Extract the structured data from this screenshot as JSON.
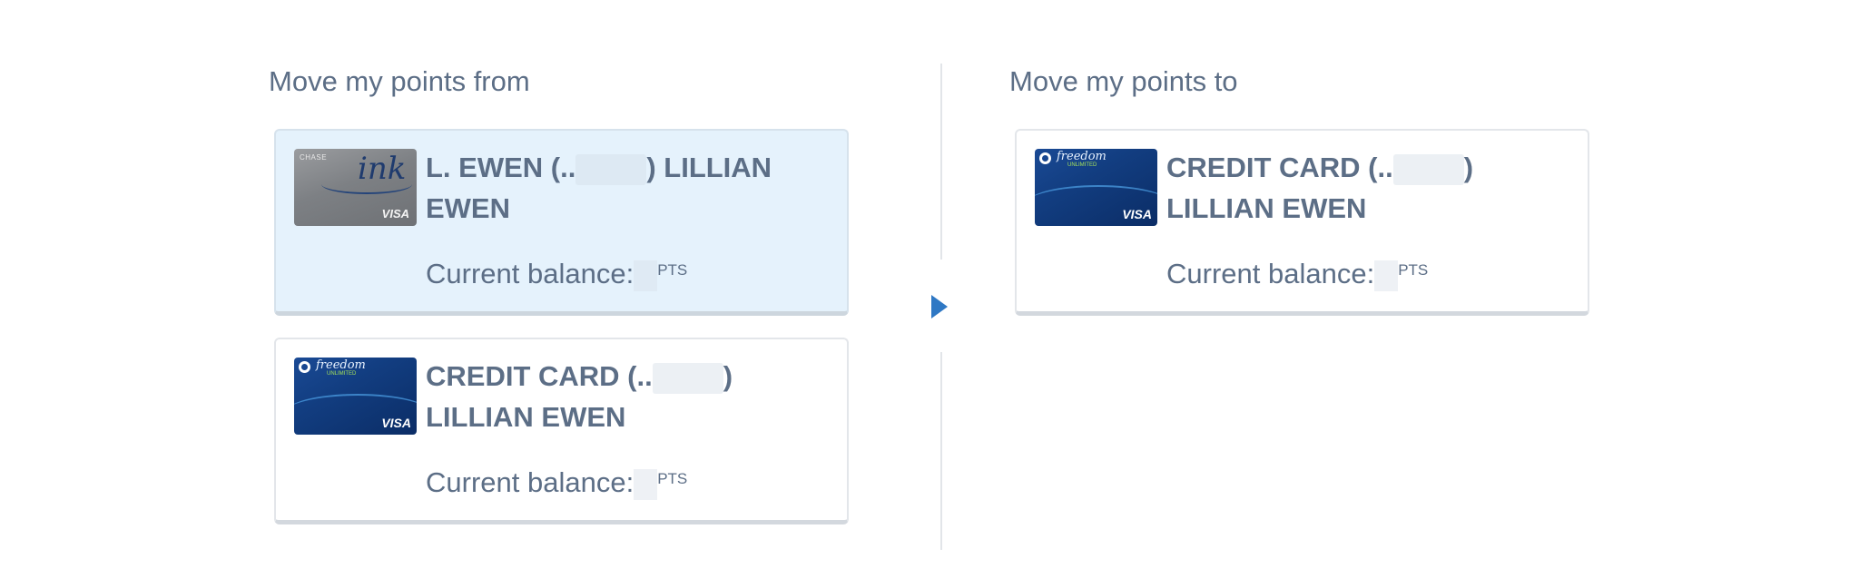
{
  "from_heading": "Move my points from",
  "to_heading": "Move my points to",
  "from_cards": [
    {
      "name_start": "L. EWEN (..",
      "name_end": ") LILLIAN EWEN",
      "balance_label": "Current balance:",
      "unit": "PTS",
      "card_art": "ink-card",
      "selected": true
    },
    {
      "name_start": "CREDIT CARD (..",
      "name_end": ") LILLIAN EWEN",
      "balance_label": "Current balance:",
      "unit": "PTS",
      "card_art": "freedom-card",
      "selected": false
    }
  ],
  "to_cards": [
    {
      "name_start": "CREDIT CARD (..",
      "name_end": ") LILLIAN EWEN",
      "balance_label": "Current balance:",
      "unit": "PTS",
      "card_art": "freedom-card",
      "selected": false
    }
  ],
  "card_art_text": {
    "ink_brand": "CHASE",
    "ink_script": "ink",
    "freedom_brand": "freedom",
    "freedom_sub": "UNLIMITED",
    "visa": "VISA"
  },
  "colors": {
    "heading": "#5c6e86",
    "selected_bg": "#e5f2fc",
    "arrow": "#2f78c4"
  }
}
